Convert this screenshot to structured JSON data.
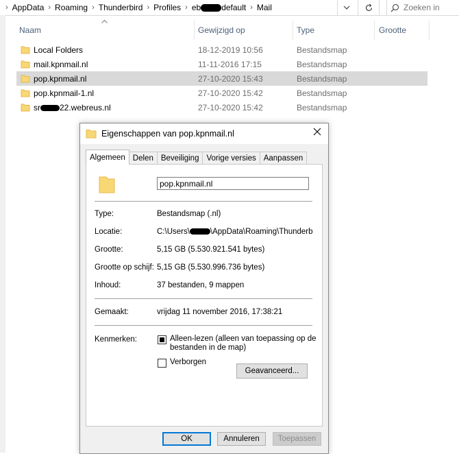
{
  "breadcrumb": {
    "items": [
      "AppData",
      "Roaming",
      "Thunderbird",
      "Profiles",
      "eb",
      "default",
      "Mail"
    ],
    "separator": "›"
  },
  "search": {
    "placeholder": "Zoeken in"
  },
  "columns": {
    "name": "Naam",
    "modified": "Gewijzigd op",
    "type": "Type",
    "size": "Grootte"
  },
  "files": [
    {
      "name": "Local Folders",
      "modified": "18-12-2019 10:56",
      "type": "Bestandsmap",
      "selected": false
    },
    {
      "name": "mail.kpnmail.nl",
      "modified": "11-11-2016 17:15",
      "type": "Bestandsmap",
      "selected": false
    },
    {
      "name": "pop.kpnmail.nl",
      "modified": "27-10-2020 15:43",
      "type": "Bestandsmap",
      "selected": true
    },
    {
      "name": "pop.kpnmail-1.nl",
      "modified": "27-10-2020 15:42",
      "type": "Bestandsmap",
      "selected": false
    },
    {
      "name_prefix": "sr",
      "name_suffix": "22.webreus.nl",
      "modified": "27-10-2020 15:42",
      "type": "Bestandsmap",
      "selected": false
    }
  ],
  "dialog": {
    "title": "Eigenschappen van pop.kpnmail.nl",
    "tabs": [
      "Algemeen",
      "Delen",
      "Beveiliging",
      "Vorige versies",
      "Aanpassen"
    ],
    "active_tab": "Algemeen",
    "folder_name": "pop.kpnmail.nl",
    "properties": {
      "type_label": "Type:",
      "type_value": "Bestandsmap (.nl)",
      "location_label": "Locatie:",
      "location_prefix": "C:\\Users\\",
      "location_suffix": "\\AppData\\Roaming\\Thunderbird",
      "size_label": "Grootte:",
      "size_value": "5,15 GB (5.530.921.541 bytes)",
      "disk_size_label": "Grootte op schijf:",
      "disk_size_value": "5,15 GB (5.530.996.736 bytes)",
      "contents_label": "Inhoud:",
      "contents_value": "37 bestanden, 9 mappen",
      "created_label": "Gemaakt:",
      "created_value": "vrijdag 11 november 2016, 17:38:21",
      "attributes_label": "Kenmerken:",
      "readonly_label_line1": "Alleen-lezen (alleen van toepassing op de",
      "readonly_label_line2": "bestanden in de map)",
      "hidden_label": "Verborgen",
      "advanced_button": "Geavanceerd..."
    },
    "buttons": {
      "ok": "OK",
      "cancel": "Annuleren",
      "apply": "Toepassen"
    }
  },
  "colors": {
    "folder": "#f8d775",
    "folder_dark": "#e8b84a",
    "selection": "#d9d9d9",
    "accent": "#0078d7",
    "header_text": "#4c607a"
  }
}
